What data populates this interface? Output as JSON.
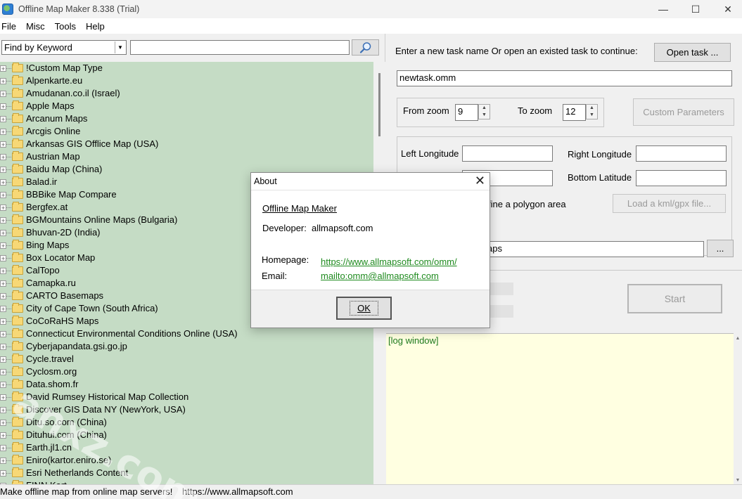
{
  "window": {
    "title": "Offline Map Maker 8.338 (Trial)",
    "minimize_glyph": "—",
    "maximize_glyph": "☐",
    "close_glyph": "✕"
  },
  "menu": [
    "File",
    "Misc",
    "Tools",
    "Help"
  ],
  "search": {
    "mode": "Find by Keyword",
    "query": ""
  },
  "tree_items": [
    "!Custom Map Type",
    "Alpenkarte.eu",
    "Amudanan.co.il (Israel)",
    "Apple Maps",
    "Arcanum Maps",
    "Arcgis Online",
    "Arkansas GIS Offlice Map (USA)",
    "Austrian Map",
    "Baidu Map (China)",
    "Balad.ir",
    "BBBike Map Compare",
    "Bergfex.at",
    "BGMountains Online Maps (Bulgaria)",
    "Bhuvan-2D (India)",
    "Bing Maps",
    "Box Locator Map",
    "CalTopo",
    "Camapka.ru",
    "CARTO Basemaps",
    "City of Cape Town (South Africa)",
    "CoCoRaHS Maps",
    "Connecticut Environmental Conditions Online (USA)",
    "Cyberjapandata.gsi.go.jp",
    "Cycle.travel",
    "Cyclosm.org",
    "Data.shom.fr",
    "David Rumsey Historical Map Collection",
    "Discover GIS Data NY (NewYork, USA)",
    "Ditu.so.com (China)",
    "Dituhui.com (China)",
    "Earth.jl1.cn",
    "Eniro(kartor.eniro.se)",
    "Esri Netherlands Content",
    "FINN Kart"
  ],
  "task": {
    "prompt": "Enter a new task name Or open an existed task to continue:",
    "open_button": "Open task ...",
    "task_name": "newtask.omm"
  },
  "zoom": {
    "from_label": "From zoom",
    "from_value": "9",
    "to_label": "To zoom",
    "to_value": "12",
    "custom_button": "Custom Parameters"
  },
  "bounds": {
    "left_lon_label": "Left Longitude",
    "right_lon_label": "Right Longitude",
    "bottom_lat_label": "Bottom Latitude",
    "polygon_text": "fine a polygon area",
    "load_kml_button": "Load a kml/gpx file..."
  },
  "output": {
    "path_fragment": "aps",
    "browse_button": "..."
  },
  "start_button": "Start",
  "log": {
    "text": "[log window]"
  },
  "status": {
    "message": "Make offline map from online map servers!",
    "url": "https://www.allmapsoft.com"
  },
  "about": {
    "title": "About",
    "app_name": "Offline Map Maker",
    "developer_label": "Developer:",
    "developer": "allmapsoft.com",
    "homepage_label": "Homepage:",
    "homepage": "https://www.allmapsoft.com/omm/",
    "email_label": "Email:",
    "email": "mailto:omm@allmapsoft.com",
    "ok_button": "OK"
  },
  "watermark": "anxz.com",
  "colors": {
    "tree_background": "#c5dcc5",
    "log_background": "#ffffe1",
    "link_color": "#1e8a1e"
  }
}
